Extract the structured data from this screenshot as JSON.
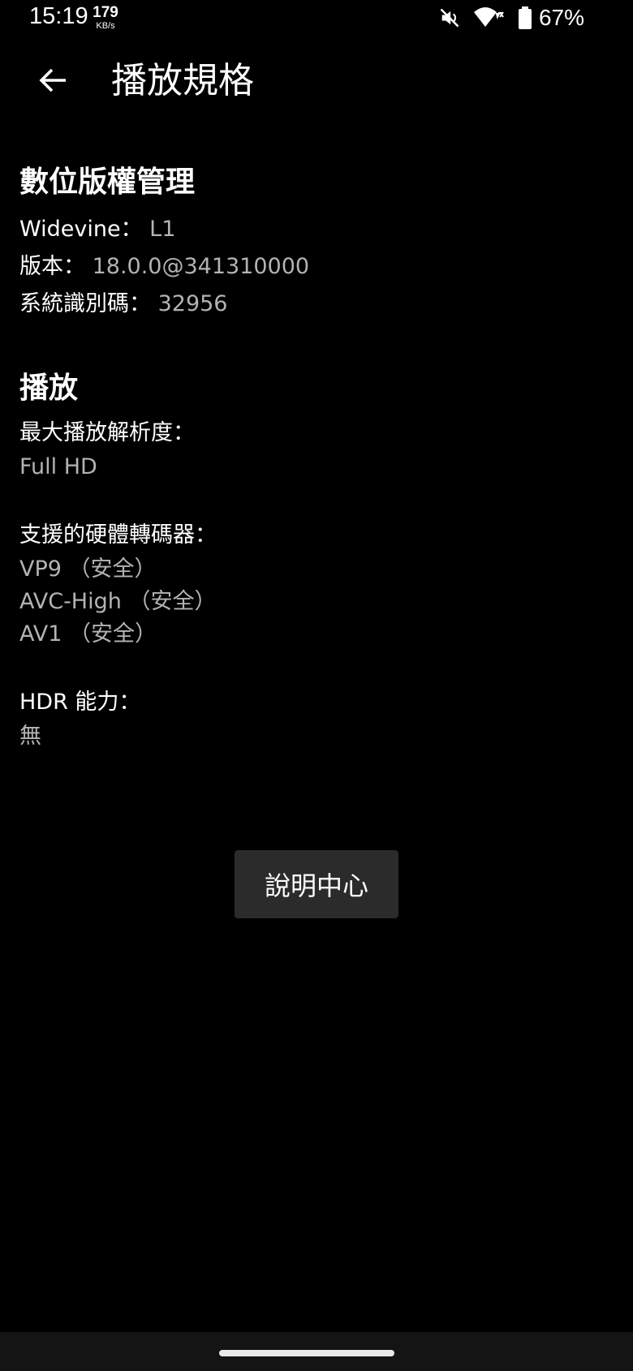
{
  "status_bar": {
    "time": "15:19",
    "net_speed_value": "179",
    "net_speed_unit": "KB/s",
    "battery_percent": "67%",
    "icons": [
      "mute-icon",
      "wifi-icon",
      "battery-icon"
    ]
  },
  "app_bar": {
    "title": "播放規格",
    "back_icon": "back-arrow-icon"
  },
  "drm": {
    "heading": "數位版權管理",
    "widevine_label": "Widevine：",
    "widevine_value": "L1",
    "version_label": "版本：",
    "version_value": "18.0.0@341310000",
    "system_id_label": "系統識別碼：",
    "system_id_value": "32956"
  },
  "playback": {
    "heading": "播放",
    "max_resolution_label": "最大播放解析度：",
    "max_resolution_value": "Full HD",
    "decoders_label": "支援的硬體轉碼器：",
    "decoders": [
      "VP9 （安全）",
      "AVC-High （安全）",
      "AV1 （安全）"
    ],
    "hdr_label": "HDR 能力：",
    "hdr_value": "無"
  },
  "help_button": {
    "label": "說明中心"
  },
  "colors": {
    "background": "#000000",
    "text_primary": "#ffffff",
    "text_secondary": "#b3b3b3",
    "button_bg": "#2b2b2b"
  }
}
